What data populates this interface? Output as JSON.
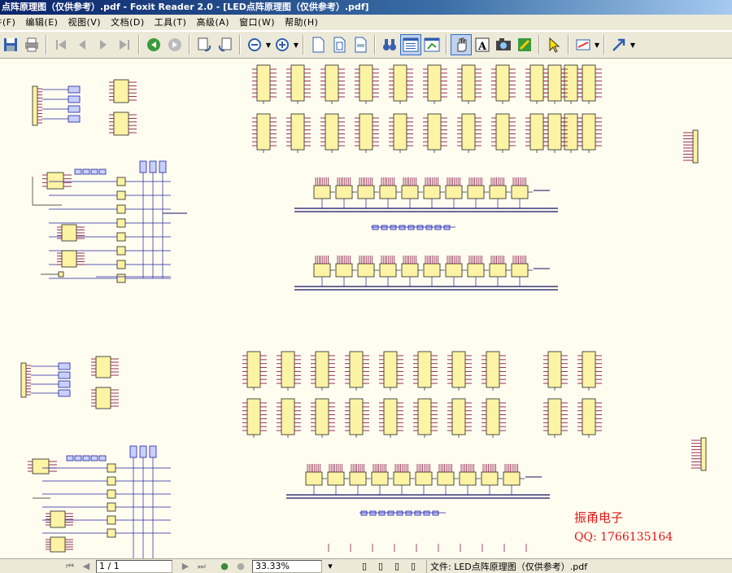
{
  "window": {
    "title": "点阵原理图（仅供参考）.pdf - Foxit Reader 2.0 - [LED点阵原理图（仅供参考）.pdf]"
  },
  "menu": [
    {
      "label": "文件(F)"
    },
    {
      "label": "编辑(E)"
    },
    {
      "label": "视图(V)"
    },
    {
      "label": "文档(D)"
    },
    {
      "label": "工具(T)"
    },
    {
      "label": "高级(A)"
    },
    {
      "label": "窗口(W)"
    },
    {
      "label": "帮助(H)"
    }
  ],
  "toolbar": [
    {
      "name": "save-icon"
    },
    {
      "name": "print-icon"
    },
    {
      "name": "sep"
    },
    {
      "name": "first-page-icon"
    },
    {
      "name": "prev-page-icon"
    },
    {
      "name": "next-page-icon"
    },
    {
      "name": "last-page-icon"
    },
    {
      "name": "sep"
    },
    {
      "name": "back-icon"
    },
    {
      "name": "forward-icon"
    },
    {
      "name": "sep"
    },
    {
      "name": "rotate-left-icon"
    },
    {
      "name": "rotate-right-icon"
    },
    {
      "name": "sep"
    },
    {
      "name": "zoom-out-icon"
    },
    {
      "name": "dropdown"
    },
    {
      "name": "zoom-in-icon"
    },
    {
      "name": "dropdown"
    },
    {
      "name": "sep"
    },
    {
      "name": "actual-size-icon"
    },
    {
      "name": "fit-page-icon"
    },
    {
      "name": "fit-width-icon"
    },
    {
      "name": "sep"
    },
    {
      "name": "binoculars-icon"
    },
    {
      "name": "bookmarks-panel-icon",
      "active": true
    },
    {
      "name": "thumbnails-icon"
    },
    {
      "name": "sep"
    },
    {
      "name": "hand-tool-icon",
      "active": true
    },
    {
      "name": "text-select-icon"
    },
    {
      "name": "snapshot-icon"
    },
    {
      "name": "typewriter-icon"
    },
    {
      "name": "sep"
    },
    {
      "name": "select-arrow-icon"
    },
    {
      "name": "sep"
    },
    {
      "name": "comment-tool-icon"
    },
    {
      "name": "dropdown"
    },
    {
      "name": "sep"
    },
    {
      "name": "arrow-tool-icon"
    },
    {
      "name": "dropdown"
    }
  ],
  "watermark": {
    "line1": "振甬电子",
    "line2": "QQ: 1766135164",
    "color": "#e01818"
  },
  "status": {
    "page_value": "1 / 1",
    "zoom_value": "33.33%",
    "file_label": "文件: LED点阵原理图（仅供参考）.pdf"
  },
  "colors": {
    "ic_fill": "#fdf3a4",
    "pin": "#8b1a4a",
    "wire": "#2020a0",
    "wire_dark": "#101060",
    "page_bg": "#fffdf0"
  }
}
